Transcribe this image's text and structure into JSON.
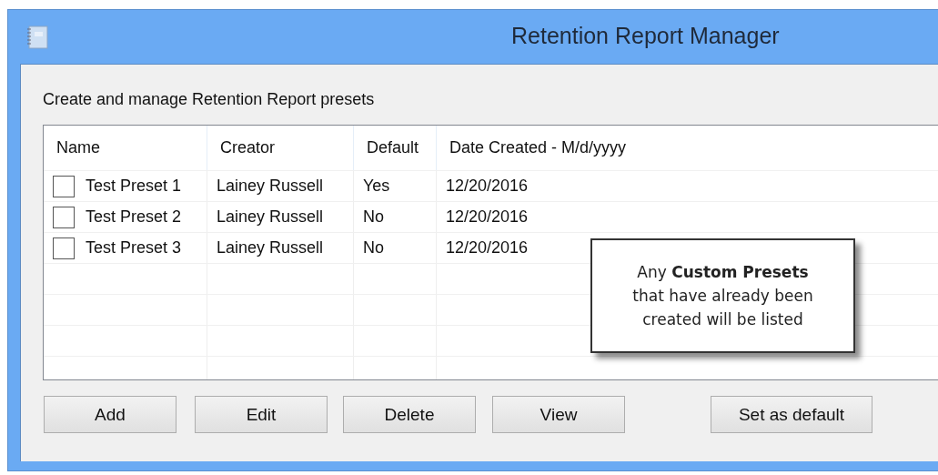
{
  "window": {
    "title": "Retention Report Manager"
  },
  "description": "Create and manage Retention Report presets",
  "table": {
    "columns": [
      "Name",
      "Creator",
      "Default",
      "Date Created - M/d/yyyy"
    ],
    "rows": [
      {
        "checked": false,
        "name": "Test Preset 1",
        "creator": "Lainey Russell",
        "default": "Yes",
        "date": "12/20/2016"
      },
      {
        "checked": false,
        "name": "Test Preset 2",
        "creator": "Lainey Russell",
        "default": "No",
        "date": "12/20/2016"
      },
      {
        "checked": false,
        "name": "Test Preset 3",
        "creator": "Lainey Russell",
        "default": "No",
        "date": "12/20/2016"
      }
    ]
  },
  "callout": "Any **Custom Presets** that have already been created will be listed",
  "buttons": [
    "Add",
    "Edit",
    "Delete",
    "View",
    "Set as default"
  ]
}
